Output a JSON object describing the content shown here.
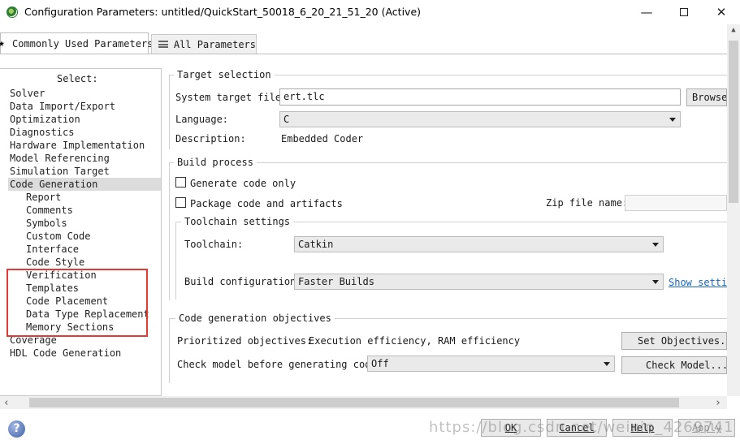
{
  "window": {
    "title": "Configuration Parameters: untitled/QuickStart_50018_6_20_21_51_20 (Active)",
    "minimize": "—",
    "close": "✕"
  },
  "tabs": [
    {
      "label": "Commonly Used Parameters",
      "active": true
    },
    {
      "label": "All Parameters",
      "active": false
    }
  ],
  "tree": {
    "title": "Select:",
    "items": [
      {
        "label": "Solver",
        "level": 0
      },
      {
        "label": "Data Import/Export",
        "level": 0
      },
      {
        "label": "Optimization",
        "level": 0
      },
      {
        "label": "Diagnostics",
        "level": 0
      },
      {
        "label": "Hardware Implementation",
        "level": 0
      },
      {
        "label": "Model Referencing",
        "level": 0
      },
      {
        "label": "Simulation Target",
        "level": 0
      },
      {
        "label": "Code Generation",
        "level": 0,
        "selected": true
      },
      {
        "label": "Report",
        "level": 1
      },
      {
        "label": "Comments",
        "level": 1
      },
      {
        "label": "Symbols",
        "level": 1
      },
      {
        "label": "Custom Code",
        "level": 1
      },
      {
        "label": "Interface",
        "level": 1
      },
      {
        "label": "Code Style",
        "level": 1
      },
      {
        "label": "Verification",
        "level": 1
      },
      {
        "label": "Templates",
        "level": 1
      },
      {
        "label": "Code Placement",
        "level": 1
      },
      {
        "label": "Data Type Replacement",
        "level": 1
      },
      {
        "label": "Memory Sections",
        "level": 1
      },
      {
        "label": "Coverage",
        "level": 0
      },
      {
        "label": "HDL Code Generation",
        "level": 0
      }
    ]
  },
  "target_selection": {
    "title": "Target selection",
    "system_target_label": "System target file:",
    "system_target_value": "ert.tlc",
    "browse": "Browse...",
    "language_label": "Language:",
    "language_value": "C",
    "description_label": "Description:",
    "description_value": "Embedded Coder"
  },
  "build_process": {
    "title": "Build process",
    "generate_code_only": "Generate code only",
    "package_code": "Package code and artifacts",
    "zip_label": "Zip file name:",
    "zip_value": "",
    "toolchain_settings": {
      "title": "Toolchain settings",
      "toolchain_label": "Toolchain:",
      "toolchain_value": "Catkin",
      "build_config_label": "Build configuration:",
      "build_config_value": "Faster Builds",
      "show_settings": "Show settin"
    }
  },
  "objectives": {
    "title": "Code generation objectives",
    "prioritized_label": "Prioritized objectives:",
    "prioritized_value": "Execution efficiency, RAM efficiency",
    "set_objectives": "Set Objectives...",
    "check_label": "Check model before generating code:",
    "check_value": "Off",
    "check_model": "Check Model..."
  },
  "footer": {
    "help_icon": "?",
    "ok": "OK",
    "cancel": "Cancel",
    "help": "Help",
    "apply": "Apply",
    "watermark": "https://blog.csdn.net/weixin_4269741"
  }
}
